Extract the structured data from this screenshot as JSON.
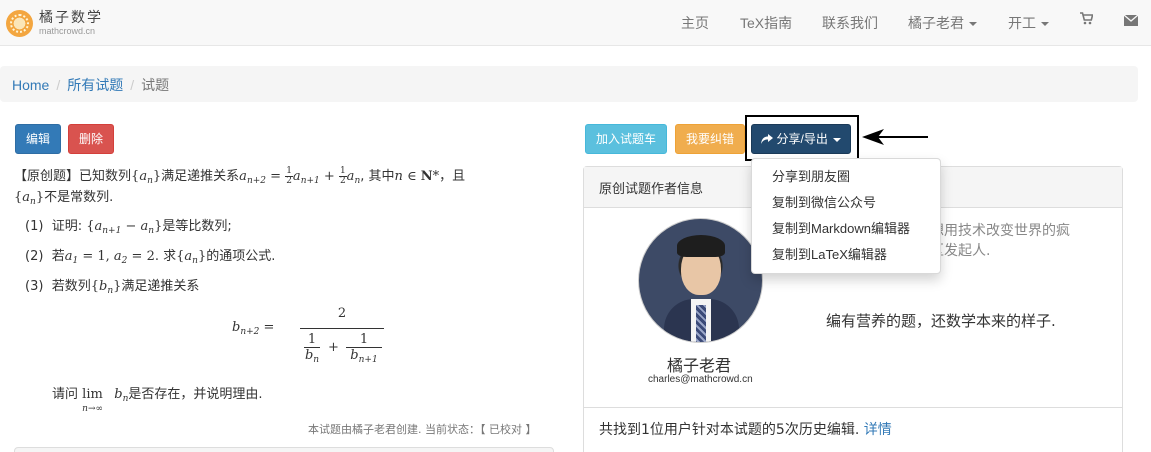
{
  "navbar": {
    "brand_name": "橘子数学",
    "brand_sub": "mathcrowd.cn",
    "items": [
      {
        "label": "主页"
      },
      {
        "label": "TeX指南"
      },
      {
        "label": "联系我们"
      },
      {
        "label": "橘子老君"
      },
      {
        "label": "开工"
      }
    ]
  },
  "breadcrumb": {
    "home": "Home",
    "all": "所有试题",
    "current": "试题"
  },
  "actions": {
    "edit": "编辑",
    "delete": "删除",
    "add_cart": "加入试题车",
    "correct": "我要纠错",
    "share": "分享/导出"
  },
  "dropdown": {
    "items": [
      "分享到朋友圈",
      "复制到微信公众号",
      "复制到Markdown编辑器",
      "复制到LaTeX编辑器"
    ]
  },
  "problem": {
    "tag": "【原创题】",
    "t1": "已知数列",
    "t2": "满足递推关系",
    "t3": ", 其中",
    "t4": "，且",
    "t5": "不是常数列.",
    "q1_num": "(1)",
    "q1_a": "证明: ",
    "q1_b": "是等比数列;",
    "q2_num": "(2)",
    "q2_a": "若",
    "q2_b": ". 求",
    "q2_c": "的通项公式.",
    "q3_num": "(3)",
    "q3_a": "若数列",
    "q3_b": "满足递推关系",
    "ask_a": "请问",
    "ask_b": "是否存在，并说明理由.",
    "note": "本试题由橘子老君创建. 当前状态：【 已校对 】"
  },
  "author_panel": {
    "heading": "原创试题作者信息",
    "name": "橘子老君",
    "email": "charles@mathcrowd.cn",
    "bio_line1": "想用技术改变世界的疯",
    "bio_line2": "区发起人.",
    "motto": "编有营养的题，还数学本来的样子.",
    "history_text": "共找到1位用户针对本试题的5次历史编辑.",
    "history_link": "详情"
  }
}
